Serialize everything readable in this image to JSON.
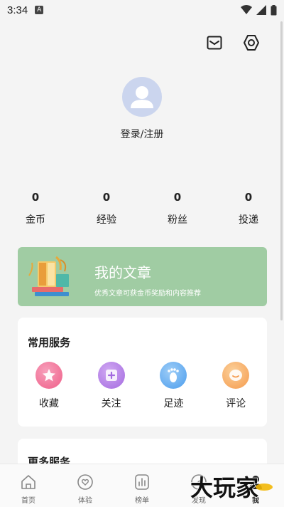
{
  "status": {
    "time": "3:34",
    "badge": "A"
  },
  "profile": {
    "login_label": "登录/注册"
  },
  "stats": [
    {
      "value": "0",
      "label": "金币"
    },
    {
      "value": "0",
      "label": "经验"
    },
    {
      "value": "0",
      "label": "粉丝"
    },
    {
      "value": "0",
      "label": "投递"
    }
  ],
  "banner": {
    "title": "我的文章",
    "subtitle": "优秀文章可获金币奖励和内容推荐"
  },
  "services": {
    "title": "常用服务",
    "items": [
      {
        "label": "收藏",
        "icon": "star-icon",
        "color": "#f06b91"
      },
      {
        "label": "关注",
        "icon": "plus-icon",
        "color": "#b07ae6"
      },
      {
        "label": "足迹",
        "icon": "footprint-icon",
        "color": "#5aa8f0"
      },
      {
        "label": "评论",
        "icon": "comment-icon",
        "color": "#f7a85b"
      }
    ]
  },
  "more_services": {
    "title": "更多服务"
  },
  "tabs": [
    {
      "label": "首页",
      "icon": "home-icon"
    },
    {
      "label": "体验",
      "icon": "heart-icon"
    },
    {
      "label": "榜单",
      "icon": "chart-icon"
    },
    {
      "label": "发现",
      "icon": "compass-icon"
    },
    {
      "label": "我",
      "icon": "user-icon"
    }
  ],
  "watermark": {
    "text": "大玩家"
  },
  "colors": {
    "banner": "#a0cca3",
    "avatar": "#cbd5ee",
    "background": "#f4f4f4"
  }
}
